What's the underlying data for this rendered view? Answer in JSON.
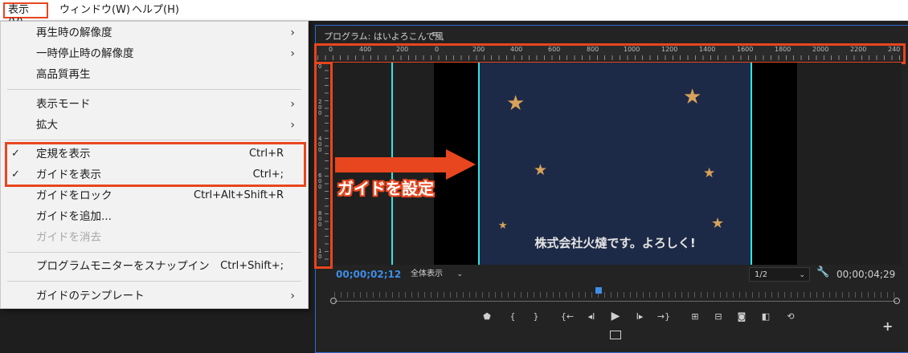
{
  "menubar": {
    "items": [
      "表示(V)",
      "ウィンドウ(W)",
      "ヘルプ(H)"
    ]
  },
  "dropdown": {
    "items": [
      {
        "label": "再生時の解像度",
        "submenu": true
      },
      {
        "label": "一時停止時の解像度",
        "submenu": true
      },
      {
        "label": "高品質再生"
      },
      {
        "label": "表示モード",
        "submenu": true
      },
      {
        "label": "拡大",
        "submenu": true
      },
      {
        "label": "定規を表示",
        "shortcut": "Ctrl+R",
        "checked": true
      },
      {
        "label": "ガイドを表示",
        "shortcut": "Ctrl+;",
        "checked": true
      },
      {
        "label": "ガイドをロック",
        "shortcut": "Ctrl+Alt+Shift+R"
      },
      {
        "label": "ガイドを追加..."
      },
      {
        "label": "ガイドを消去",
        "disabled": true
      },
      {
        "label": "プログラムモニターをスナップイン",
        "shortcut": "Ctrl+Shift+;"
      },
      {
        "label": "ガイドのテンプレート",
        "submenu": true
      }
    ],
    "check_mark": "✓",
    "submenu_arrow": "›"
  },
  "monitor": {
    "title": "プログラム: はいよろこんで風",
    "menu_icon": "≡",
    "ruler_labels": [
      "0",
      "400",
      "200",
      "0",
      "200",
      "400",
      "600",
      "800",
      "1000",
      "1200",
      "1400",
      "1600",
      "1800",
      "2000",
      "2200",
      "240"
    ],
    "vruler_labels": [
      "0",
      "200",
      "400",
      "600",
      "800",
      "10"
    ],
    "caption": "株式会社火燵です。よろしく!",
    "annotation": "ガイドを設定",
    "timecode_current": "00;00;02;12",
    "zoom_select": "全体表示",
    "resolution_select": "1/2",
    "timecode_duration": "00;00;04;29",
    "playhead_fraction": 0.47
  },
  "controls": {
    "items": [
      "marker",
      "in",
      "out",
      "go-in",
      "step-back",
      "play",
      "step-fwd",
      "go-out",
      "lift",
      "extract",
      "camera",
      "compare",
      "loop",
      "safe",
      "plus"
    ]
  },
  "colors": {
    "highlight": "#e8461f",
    "timecode": "#3d8ee6",
    "guide": "#2ee6e6",
    "star": "#d7a25a",
    "video_bg": "#1d2a47"
  }
}
